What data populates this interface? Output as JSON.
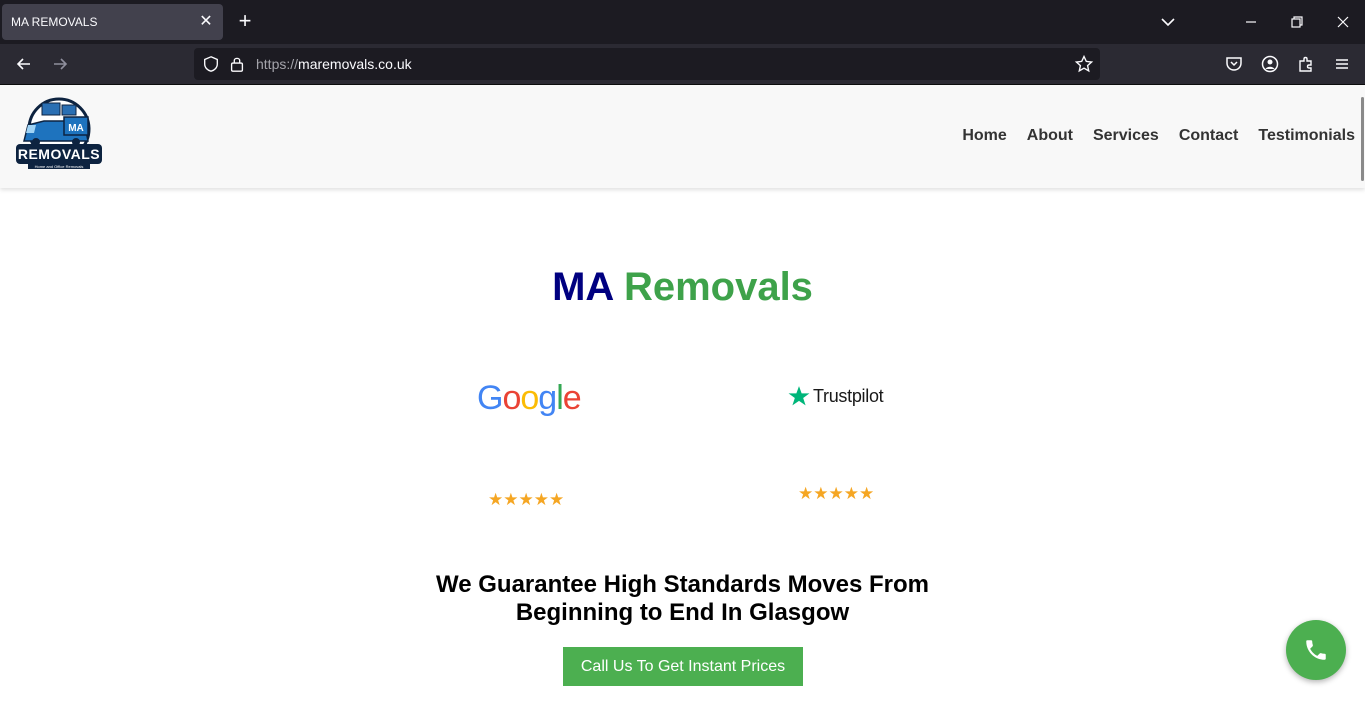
{
  "browser": {
    "tab_title": "MA REMOVALS",
    "tab_close": "✕",
    "new_tab": "+",
    "url_protocol": "https://",
    "url_host": "maremovals.co.uk"
  },
  "header": {
    "menu": [
      {
        "label": "Home"
      },
      {
        "label": "About"
      },
      {
        "label": "Services"
      },
      {
        "label": "Contact"
      },
      {
        "label": "Testimonials"
      }
    ]
  },
  "logo": {
    "text": "REMOVALS",
    "van_text": "MA",
    "tagline": "Home and Office Removals"
  },
  "hero": {
    "title_part1": "MA",
    "title_part2": "Removals"
  },
  "reviews": {
    "google": {
      "letters": [
        "G",
        "o",
        "o",
        "g",
        "l",
        "e"
      ],
      "stars": "★★★★★"
    },
    "trustpilot": {
      "name": "Trustpilot",
      "stars": "★★★★★"
    }
  },
  "guarantee": {
    "line1": "We Guarantee High Standards Moves From",
    "line2": "Beginning to End In Glasgow"
  },
  "cta": {
    "label": "Call Us To Get Instant Prices"
  },
  "colors": {
    "navy": "#000080",
    "green": "#3ea24a",
    "button_green": "#4caf50",
    "star_orange": "#f5a623"
  }
}
